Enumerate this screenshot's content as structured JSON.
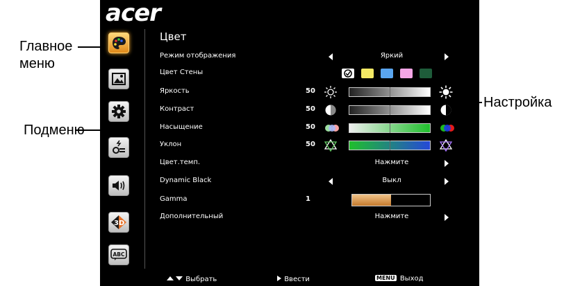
{
  "callouts": {
    "main_menu": [
      "Главное",
      "меню"
    ],
    "submenu": "Подменю",
    "settings": "Настройка"
  },
  "osd": {
    "logo": "acer",
    "title": "Цвет",
    "sidebar_icons": [
      "palette-icon",
      "image-icon",
      "gear-icon",
      "lamp-icon",
      "speaker-icon",
      "3d-icon",
      "abc-language-icon"
    ],
    "active_sidebar": 0,
    "rows": [
      {
        "id": "display-mode",
        "label": "Режим отображения",
        "type": "select",
        "value": "Яркий"
      },
      {
        "id": "wall-color",
        "label": "Цвет Стены",
        "type": "swatches",
        "swatches": [
          "#ffffff",
          "#f4ea65",
          "#5aa6f0",
          "#f5a6e6",
          "#1e5c3a"
        ],
        "selected": 0
      },
      {
        "id": "brightness",
        "label": "Яркость",
        "type": "slider",
        "value": "50",
        "level": 50
      },
      {
        "id": "contrast",
        "label": "Контраст",
        "type": "slider",
        "value": "50",
        "level": 50
      },
      {
        "id": "saturation",
        "label": "Насыщение",
        "type": "slider",
        "value": "50",
        "level": 50
      },
      {
        "id": "tint",
        "label": "Уклон",
        "type": "slider",
        "value": "50",
        "level": 50
      },
      {
        "id": "color-temp",
        "label": "Цвет.темп.",
        "type": "action",
        "value": "Нажмите"
      },
      {
        "id": "dynamic-black",
        "label": "Dynamic Black",
        "type": "select",
        "value": "Выкл"
      },
      {
        "id": "gamma",
        "label": "Gamma",
        "type": "gamma",
        "value": "1",
        "level": 0.5
      },
      {
        "id": "advanced",
        "label": "Дополнительный",
        "type": "action",
        "value": "Нажмите"
      }
    ],
    "footer": {
      "select": "Выбрать",
      "enter": "Ввести",
      "menu_key": "MENU",
      "exit": "Выход"
    }
  }
}
